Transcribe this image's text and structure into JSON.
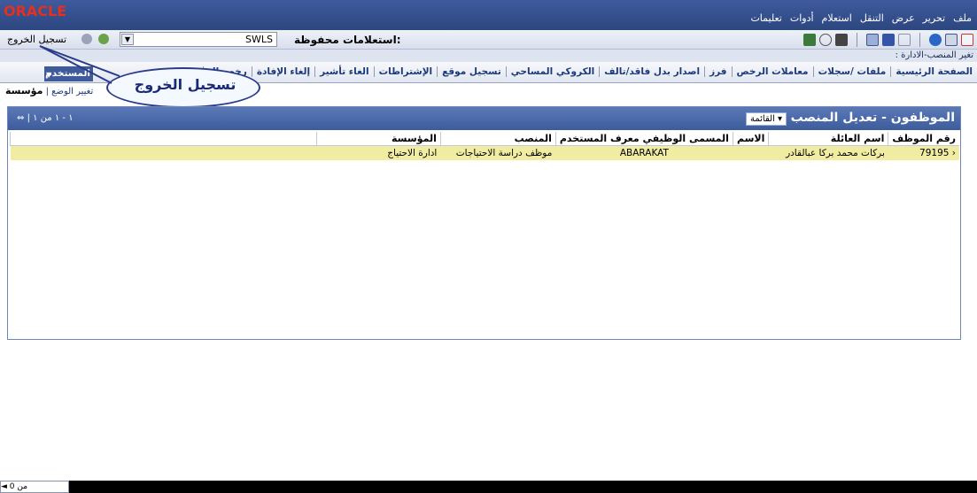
{
  "app": {
    "logo": "ORACLE"
  },
  "menu": [
    "ملف",
    "تحرير",
    "عرض",
    "التنقل",
    "استعلام",
    "أدوات",
    "تعليمات"
  ],
  "toolbar": {
    "saved_queries_label": "استعلامات محفوظة:",
    "saved_query_value": "SWLS",
    "logout_label": "تسجيل الخروج"
  },
  "breadcrumb": "تغير المنصب-الادارة :",
  "tabs": [
    "الصفحة الرئيسية",
    "ملفات /سجلات",
    "معاملات الرخص",
    "فرز",
    "اصدار بدل فاقد/تالف",
    "الكروكي المساحي",
    "تسجيل موقع",
    "الإشتراطات",
    "الغاء تأشير",
    "إلغاء الإفادة",
    "رخص ال"
  ],
  "user_tab": "المستخدم",
  "subtabs": {
    "active": "مؤسسة",
    "other": "تغيير الوضع"
  },
  "callout": "تسجيل الخروج",
  "panel": {
    "title": "الموظفون - تعديل المنصب",
    "view_label": "القائمة",
    "paging": "١ - ١ من ١"
  },
  "table": {
    "headers": [
      "رقم الموظف",
      "اسم العائلة",
      "الاسم",
      "المسمى الوظيفي معرف المستخدم",
      "المنصب",
      "المؤسسة"
    ],
    "rows": [
      {
        "emp_no": "79195",
        "name": "بركات محمد بركا عبالقادر",
        "user_id": "ABARAKAT",
        "position": "موظف دراسة الاحتياجات",
        "org": "ادارة الاحتياج"
      }
    ]
  },
  "bottom": {
    "page_text": "0 من"
  },
  "colors": {
    "header_blue": "#3d5c9d",
    "selected_row": "#f0eda2",
    "logo_red": "#e3311e"
  }
}
